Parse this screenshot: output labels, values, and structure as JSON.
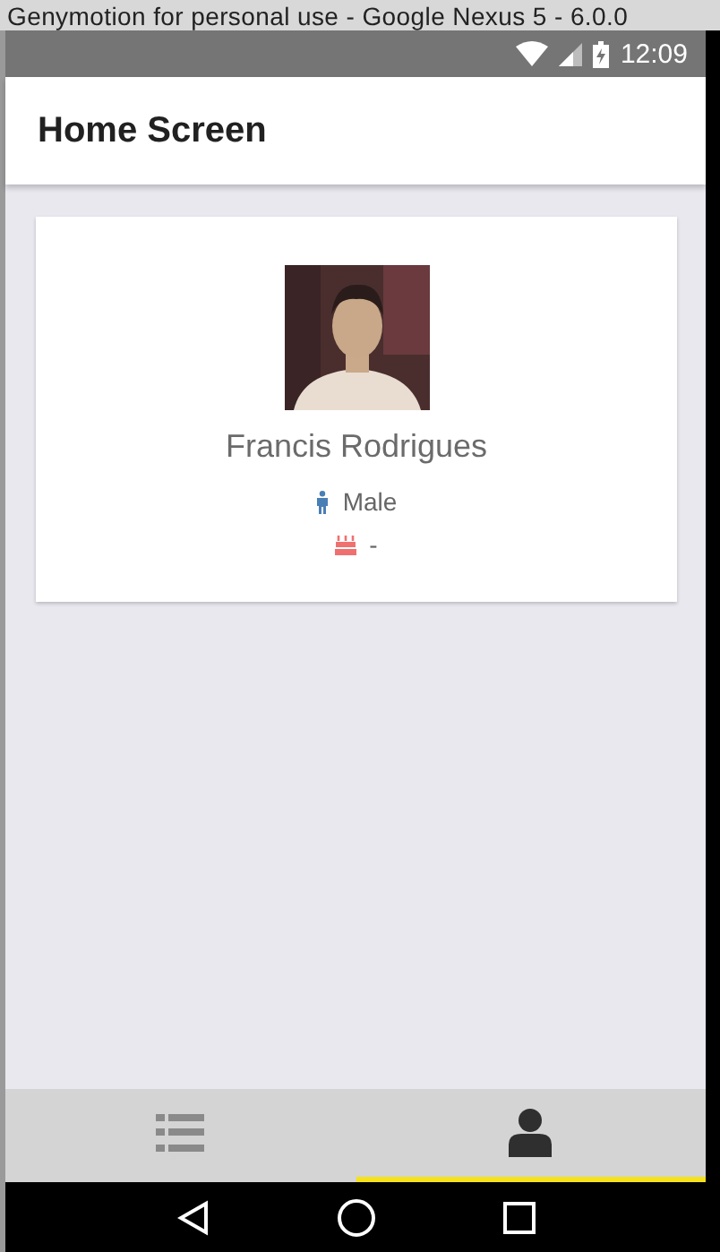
{
  "window": {
    "title": "Genymotion for personal use - Google Nexus 5 - 6.0.0"
  },
  "status_bar": {
    "time": "12:09"
  },
  "app_bar": {
    "title": "Home Screen"
  },
  "profile": {
    "name": "Francis Rodrigues",
    "details": [
      {
        "kind": "gender",
        "text": "Male"
      },
      {
        "kind": "birthday",
        "text": "-"
      }
    ]
  },
  "tabs": [
    {
      "kind": "list",
      "selected": false
    },
    {
      "kind": "person",
      "selected": true
    }
  ]
}
